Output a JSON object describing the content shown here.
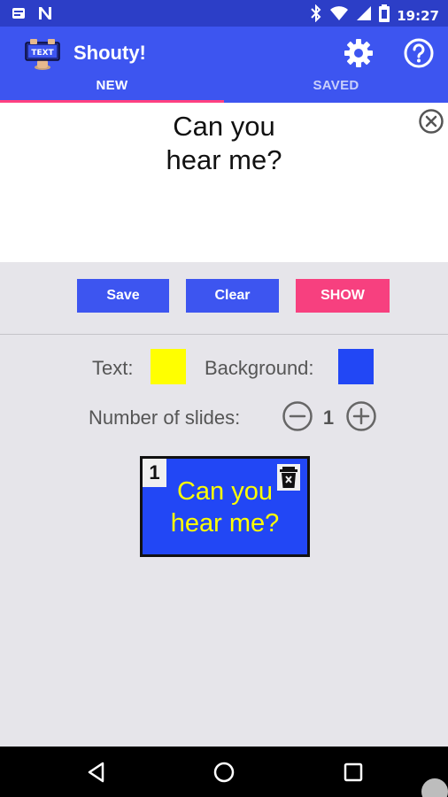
{
  "status_bar": {
    "time": "19:27",
    "icons_left": [
      "notification-icon",
      "n-app-icon"
    ],
    "icons_right": [
      "bluetooth-icon",
      "wifi-icon",
      "signal-icon",
      "battery-icon"
    ]
  },
  "app": {
    "title": "Shouty!",
    "logo_text": "TEXT",
    "accent_color": "#3d55f0",
    "tabs": [
      {
        "label": "NEW",
        "selected": true
      },
      {
        "label": "SAVED",
        "selected": false
      }
    ]
  },
  "editor": {
    "text": "Can you\nhear me?"
  },
  "actions": {
    "save_label": "Save",
    "clear_label": "Clear",
    "show_label": "SHOW",
    "show_color": "#f7407f"
  },
  "colors": {
    "text_label": "Text:",
    "text_color": "#ffff00",
    "background_label": "Background:",
    "background_color": "#2247f5"
  },
  "slides": {
    "label": "Number of slides:",
    "count": "1",
    "items": [
      {
        "number": "1",
        "text": "Can you\nhear me?"
      }
    ]
  }
}
